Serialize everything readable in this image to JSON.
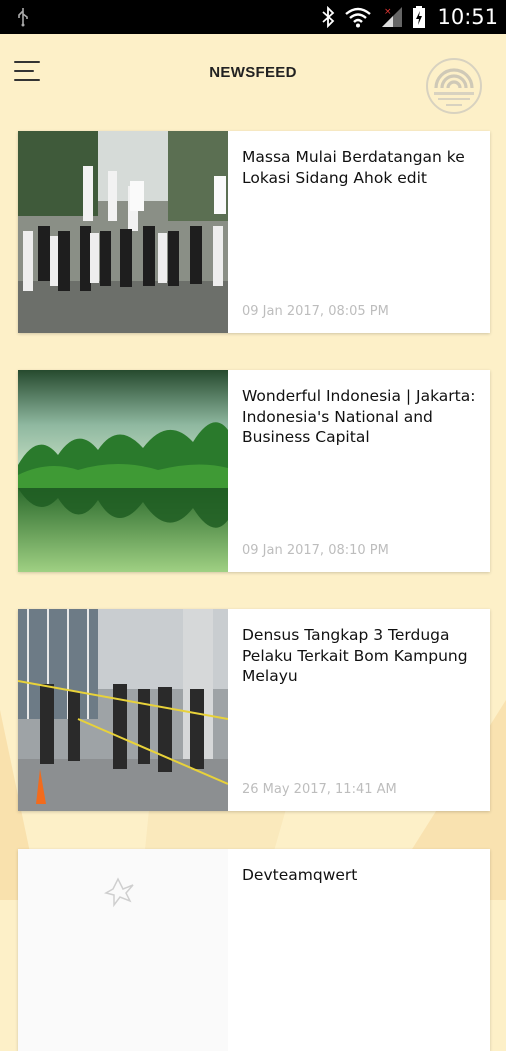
{
  "status_bar": {
    "time": "10:51"
  },
  "app_bar": {
    "title": "NEWSFEED"
  },
  "news": [
    {
      "title": "Massa Mulai Berdatangan ke Lokasi Sidang Ahok edit",
      "date": "09 Jan 2017, 08:05 PM"
    },
    {
      "title": "Wonderful Indonesia | Jakarta: Indonesia's National and Business Capital",
      "date": "09 Jan 2017, 08:10 PM"
    },
    {
      "title": "Densus Tangkap 3 Terduga Pelaku Terkait Bom Kampung Melayu",
      "date": "26 May 2017, 11:41 AM"
    },
    {
      "title": "Devteamqwert",
      "date": ""
    }
  ],
  "colors": {
    "background": "#fdf0c8",
    "card": "#ffffff",
    "date_text": "#bdbdbd"
  }
}
